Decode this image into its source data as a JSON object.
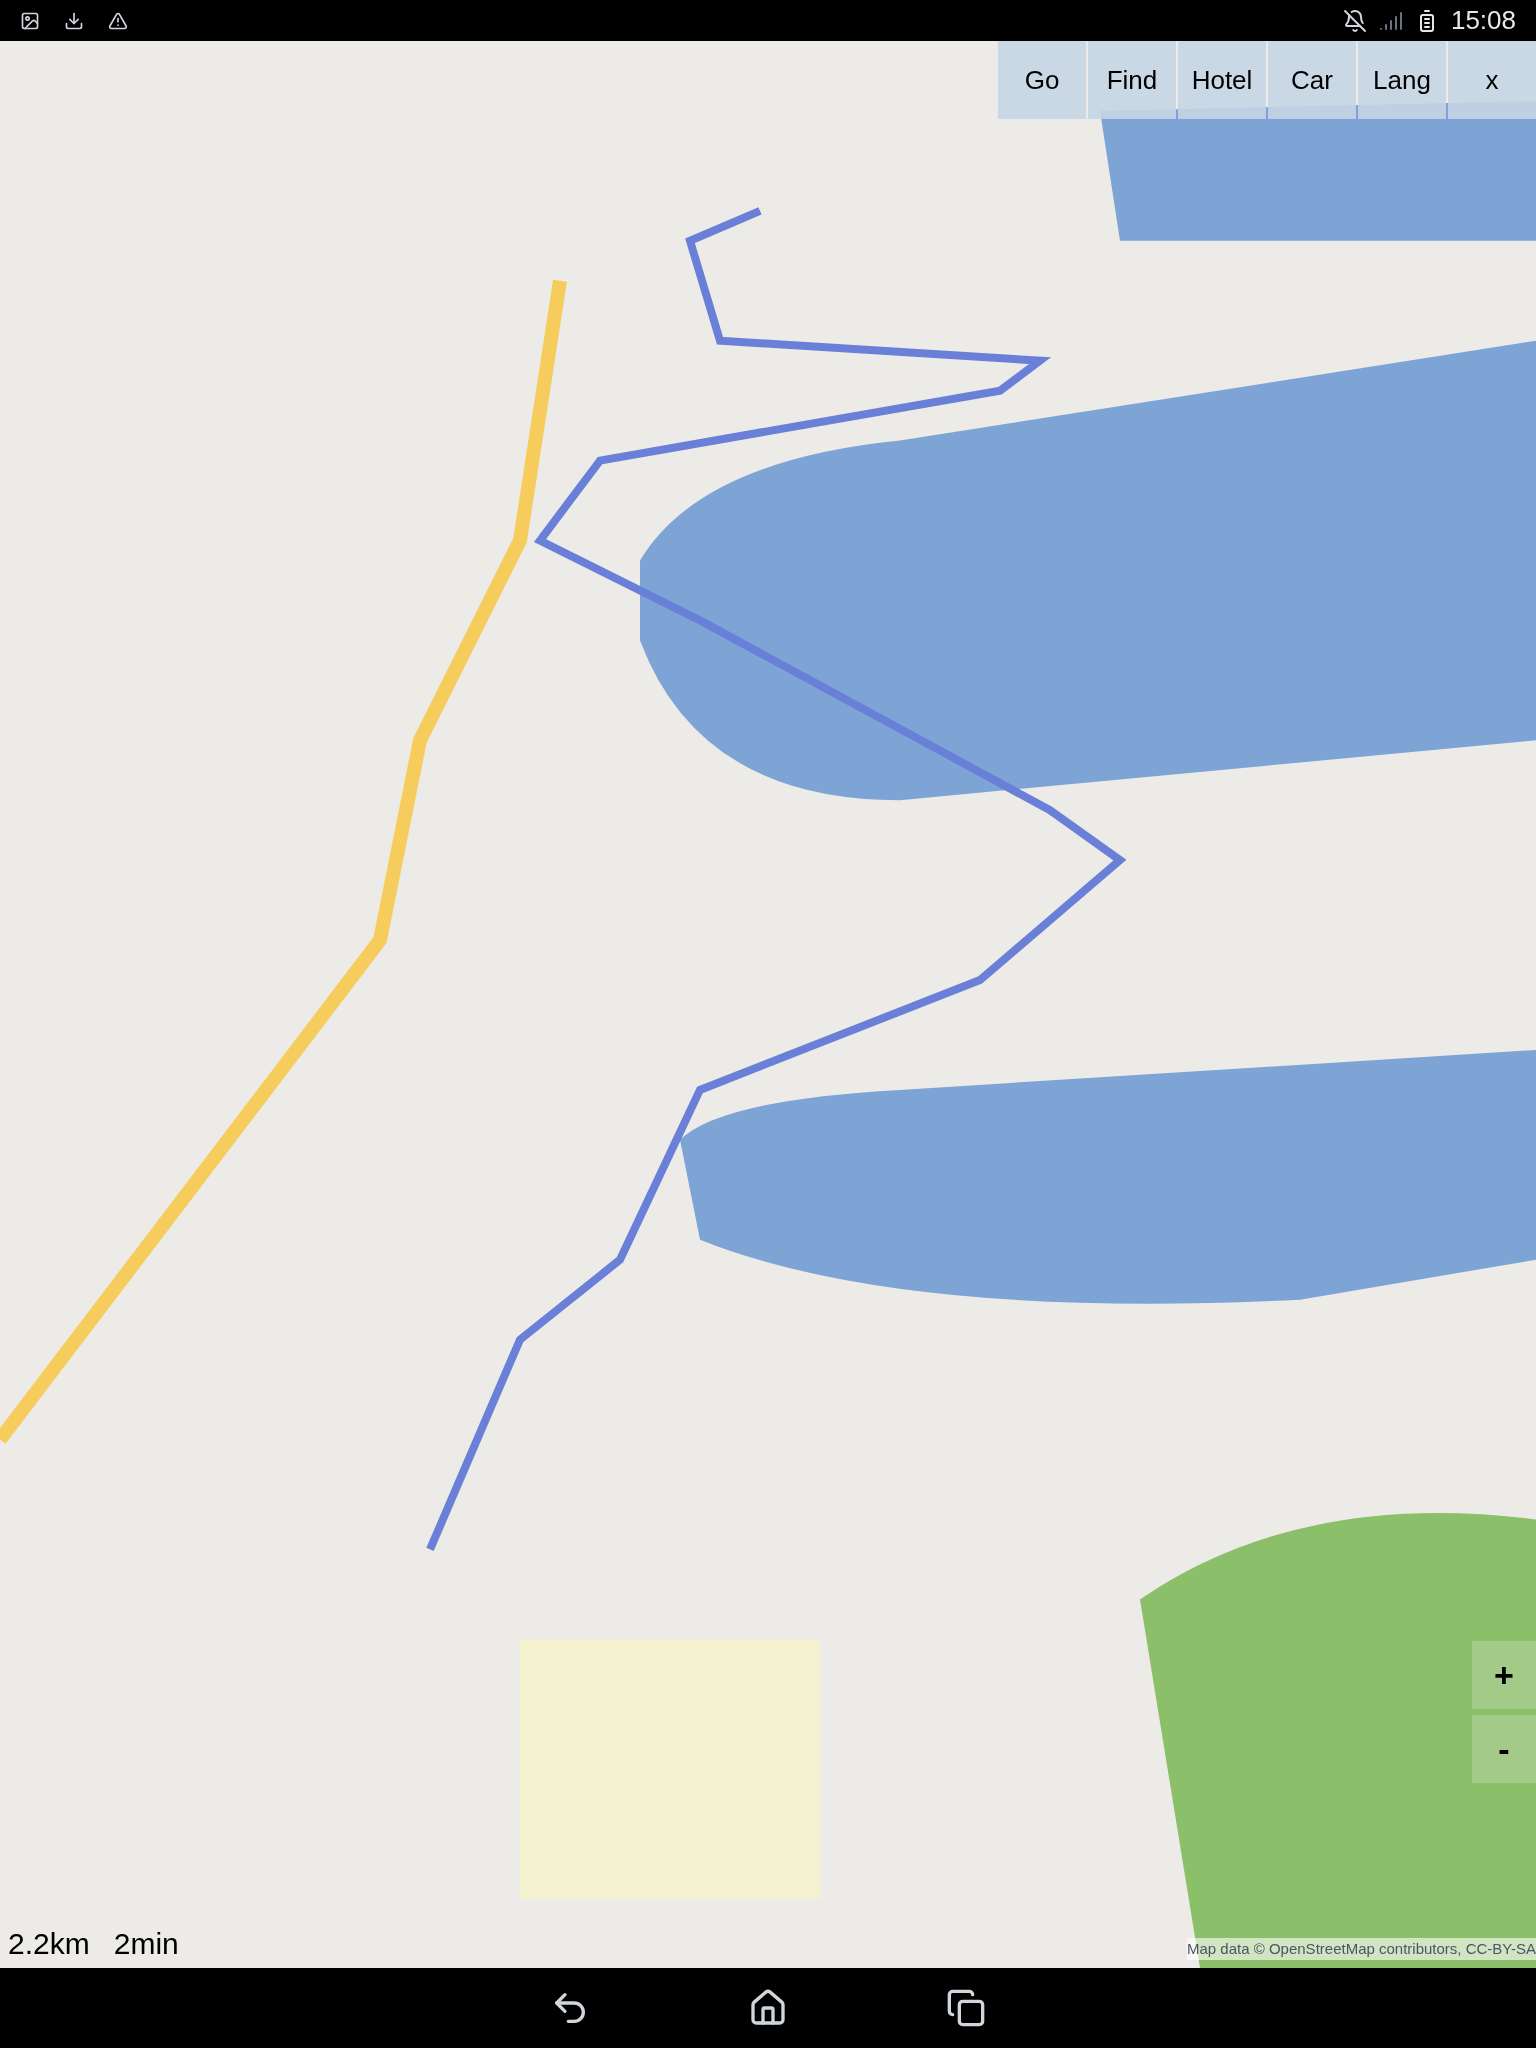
{
  "status_bar": {
    "time": "15:08"
  },
  "toolbar": {
    "buttons": [
      "Go",
      "Find",
      "Hotel",
      "Car",
      "Lang",
      "x"
    ]
  },
  "zoom_controls": {
    "zoom_in": "+",
    "zoom_out": "-"
  },
  "route_summary": {
    "distance": "2.2km",
    "duration": "2min"
  },
  "attribution": "Map data © OpenStreetMap contributors, CC-BY-SA"
}
